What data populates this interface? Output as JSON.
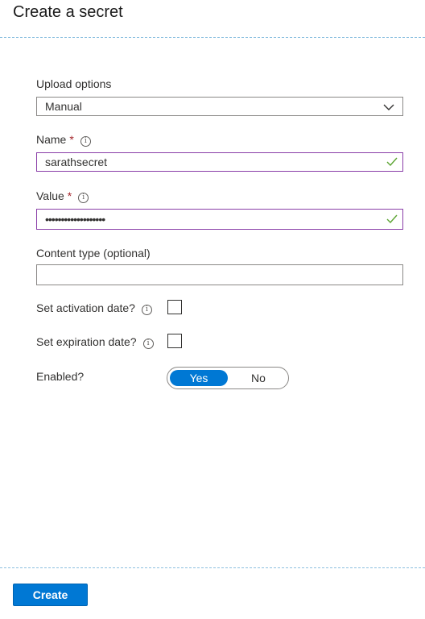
{
  "header": {
    "title": "Create a secret"
  },
  "form": {
    "upload_options": {
      "label": "Upload options",
      "value": "Manual"
    },
    "name": {
      "label": "Name",
      "required_mark": "*",
      "value": "sarathsecret"
    },
    "value": {
      "label": "Value",
      "required_mark": "*",
      "masked_value": "•••••••••••••••••••"
    },
    "content_type": {
      "label": "Content type (optional)",
      "value": ""
    },
    "activation": {
      "label": "Set activation date?",
      "checked": false
    },
    "expiration": {
      "label": "Set expiration date?",
      "checked": false
    },
    "enabled": {
      "label": "Enabled?",
      "yes": "Yes",
      "no": "No",
      "selected": "Yes"
    }
  },
  "footer": {
    "create_label": "Create"
  },
  "icons": {
    "info": "info-icon",
    "check": "checkmark-icon",
    "chevron": "chevron-down-icon"
  },
  "colors": {
    "accent": "#0078d4",
    "required": "#a4262c",
    "valid_border": "#8a3ea8",
    "check": "#5ba431"
  }
}
